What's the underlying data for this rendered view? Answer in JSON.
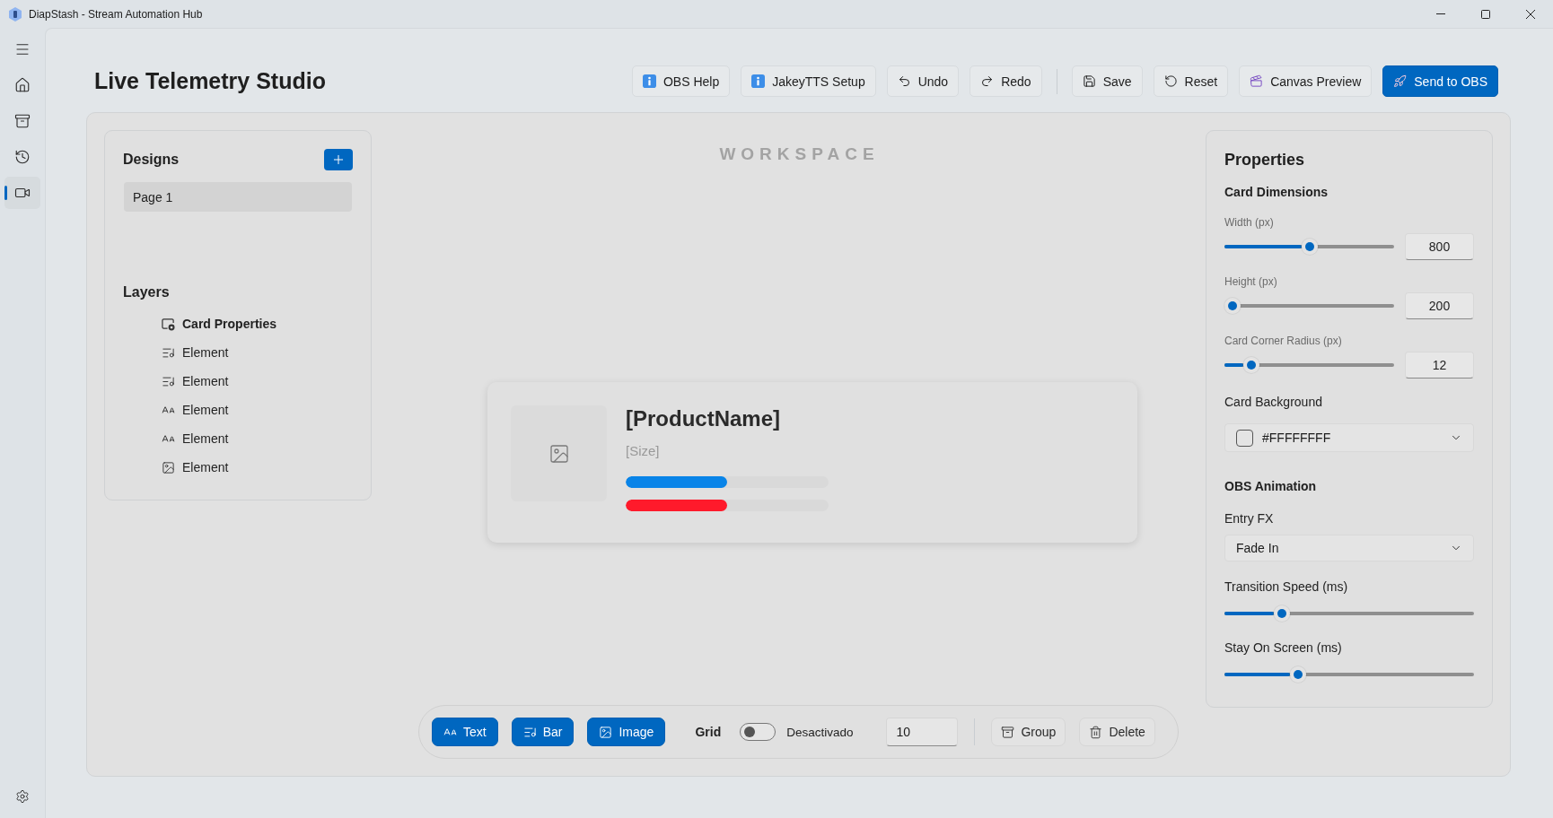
{
  "window": {
    "title": "DiapStash - Stream Automation Hub"
  },
  "nav": {
    "items": [
      {
        "kind": "home",
        "selected": false
      },
      {
        "kind": "archive",
        "selected": false
      },
      {
        "kind": "history",
        "selected": false
      },
      {
        "kind": "video",
        "selected": true
      }
    ]
  },
  "header": {
    "title": "Live Telemetry Studio",
    "action_groups": [
      [
        {
          "label": "OBS Help",
          "kind": "info",
          "primary": false
        },
        {
          "label": "JakeyTTS Setup",
          "kind": "info",
          "primary": false
        },
        {
          "label": "Undo",
          "kind": "undo",
          "primary": false
        },
        {
          "label": "Redo",
          "kind": "redo",
          "primary": false
        }
      ],
      [
        {
          "label": "Save",
          "kind": "save",
          "primary": false
        },
        {
          "label": "Reset",
          "kind": "reset",
          "primary": false
        },
        {
          "label": "Canvas Preview",
          "kind": "preview",
          "primary": false
        },
        {
          "label": "Send to OBS",
          "kind": "send",
          "primary": true
        }
      ]
    ]
  },
  "designs": {
    "title": "Designs",
    "pages": [
      {
        "label": "Page 1",
        "selected": true
      }
    ]
  },
  "layers": {
    "title": "Layers",
    "items": [
      {
        "label": "Card Properties",
        "kind": "card",
        "selected": true
      },
      {
        "label": "Element",
        "kind": "bar",
        "selected": false
      },
      {
        "label": "Element",
        "kind": "bar",
        "selected": false
      },
      {
        "label": "Element",
        "kind": "text",
        "selected": false
      },
      {
        "label": "Element",
        "kind": "text",
        "selected": false
      },
      {
        "label": "Element",
        "kind": "image",
        "selected": false
      }
    ]
  },
  "workspace": {
    "label": "WORKSPACE",
    "card": {
      "title": "[ProductName]",
      "subtitle": "[Size]",
      "bars": [
        {
          "level": 0.5,
          "color": "#0984e8"
        },
        {
          "level": 0.5,
          "color": "#ff1a2b"
        }
      ]
    }
  },
  "toolbar": {
    "tools": [
      {
        "label": "Text",
        "kind": "text"
      },
      {
        "label": "Bar",
        "kind": "bar"
      },
      {
        "label": "Image",
        "kind": "image"
      }
    ],
    "grid": {
      "label": "Grid",
      "on": false,
      "status": "Desactivado",
      "spacing": "10"
    },
    "actions": [
      {
        "label": "Group",
        "kind": "group"
      },
      {
        "label": "Delete",
        "kind": "delete"
      }
    ]
  },
  "properties": {
    "title": "Properties",
    "sections": [
      {
        "title": "Card Dimensions",
        "fields": [
          {
            "kind": "slider",
            "label": "Width (px)",
            "level": 0.5,
            "value": "800"
          },
          {
            "kind": "slider",
            "label": "Height (px)",
            "level": 0,
            "value": "200"
          },
          {
            "kind": "slider",
            "label": "Card Corner Radius (px)",
            "level": 0.12,
            "value": "12"
          },
          {
            "kind": "color",
            "label": "Card Background",
            "value": "#FFFFFFFF"
          }
        ]
      },
      {
        "title": "OBS Animation",
        "fields": [
          {
            "kind": "select",
            "label": "Entry FX",
            "value": "Fade In"
          },
          {
            "kind": "slider",
            "label": "Transition Speed (ms)",
            "level": 0.21
          },
          {
            "kind": "slider",
            "label": "Stay On Screen (ms)",
            "level": 0.28
          }
        ]
      }
    ]
  }
}
